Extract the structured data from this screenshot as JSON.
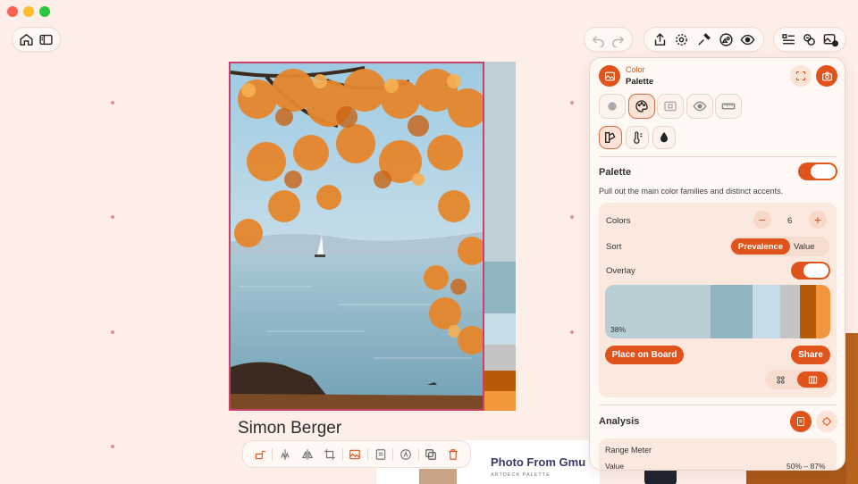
{
  "window": {
    "traffic_colors": [
      "#ff5f57",
      "#febc2e",
      "#28c840"
    ]
  },
  "toolbar": {
    "left_icons": [
      "home-icon",
      "sidebar-icon"
    ],
    "history_icons": [
      "undo-icon",
      "redo-icon"
    ],
    "action_icons": [
      "share-icon",
      "gear-icon",
      "eyedropper-icon",
      "shapes-icon",
      "eye-icon"
    ],
    "right_icons": [
      "list-icon",
      "palette-link-icon",
      "add-image-icon"
    ]
  },
  "canvas": {
    "caption": "Simon Berger",
    "card_title": "Photo From Gmu",
    "card_subtitle": "ARTDECK PALETTE"
  },
  "bottom_toolbar": {
    "icons": [
      "lock-icon",
      "align-icon",
      "flip-icon",
      "crop-icon",
      "image-icon",
      "note-icon",
      "color-icon",
      "duplicate-icon",
      "trash-icon"
    ]
  },
  "panel": {
    "category": "Color",
    "title": "Palette",
    "mode_tiles": [
      "circle-icon",
      "palette-icon",
      "frame-icon",
      "eye-icon",
      "ruler-icon"
    ],
    "sub_tiles": [
      "palette-swatch-icon",
      "color-temp-icon",
      "drop-icon"
    ],
    "palette_heading": "Palette",
    "palette_description": "Pull out the main color families and distinct accents.",
    "colors_label": "Colors",
    "colors_value": "6",
    "sort_label": "Sort",
    "sort_options": [
      "Prevalence",
      "Value"
    ],
    "overlay_label": "Overlay",
    "swatches": [
      {
        "color": "#b9cdd4",
        "share": 0.38
      },
      {
        "color": "#8fb4c2",
        "share": 0.15
      },
      {
        "color": "#c6dce6",
        "share": 0.1
      },
      {
        "color": "#c4c4c4",
        "share": 0.07
      },
      {
        "color": "#b85a08",
        "share": 0.06
      },
      {
        "color": "#f3973d",
        "share": 0.05
      }
    ],
    "swatch_percent": "38%",
    "place_button": "Place on Board",
    "share_button": "Share",
    "analysis_heading": "Analysis",
    "range_meter_label": "Range Meter",
    "value_label": "Value",
    "value_range": "50% – 87%"
  },
  "colors": {
    "accent": "#e0541c",
    "background": "#fdeee8"
  }
}
